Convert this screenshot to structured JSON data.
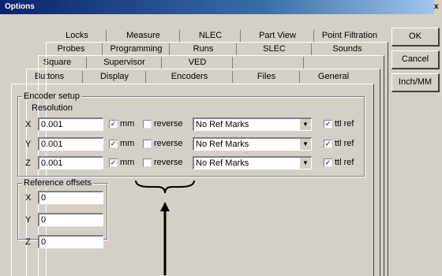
{
  "window": {
    "title": "Options",
    "close_glyph": "x"
  },
  "tabs": {
    "row1": [
      "Locks",
      "Measure",
      "NLEC",
      "Part View",
      "Point Filtration"
    ],
    "row2": [
      "Probes",
      "Programming",
      "Runs",
      "SLEC",
      "Sounds"
    ],
    "row3": [
      "Square",
      "Supervisor",
      "VED",
      "",
      ""
    ],
    "row4": [
      "Buttons",
      "Display",
      "Encoders",
      "Files",
      "General"
    ],
    "active": "Encoders"
  },
  "buttons": {
    "ok": "OK",
    "cancel": "Cancel",
    "units": "Inch/MM"
  },
  "encoder_setup": {
    "title": "Encoder setup",
    "resolution_label": "Resolution",
    "rows": [
      {
        "axis": "X",
        "value": "0.001",
        "mm_label": "mm",
        "mm_checked": true,
        "reverse_label": "reverse",
        "reverse_checked": false,
        "ref_marks": "No Ref Marks",
        "ttl_label": "ttl ref",
        "ttl_checked": true
      },
      {
        "axis": "Y",
        "value": "0.001",
        "mm_label": "mm",
        "mm_checked": true,
        "reverse_label": "reverse",
        "reverse_checked": false,
        "ref_marks": "No Ref Marks",
        "ttl_label": "ttl ref",
        "ttl_checked": true
      },
      {
        "axis": "Z",
        "value": "0.001",
        "mm_label": "mm",
        "mm_checked": true,
        "reverse_label": "reverse",
        "reverse_checked": false,
        "ref_marks": "No Ref Marks",
        "ttl_label": "ttl ref",
        "ttl_checked": true
      }
    ]
  },
  "reference_offsets": {
    "title": "Reference offsets",
    "rows": [
      {
        "axis": "X",
        "value": "0"
      },
      {
        "axis": "Y",
        "value": "0"
      },
      {
        "axis": "Z",
        "value": "0"
      }
    ]
  },
  "check_glyph": "✓"
}
